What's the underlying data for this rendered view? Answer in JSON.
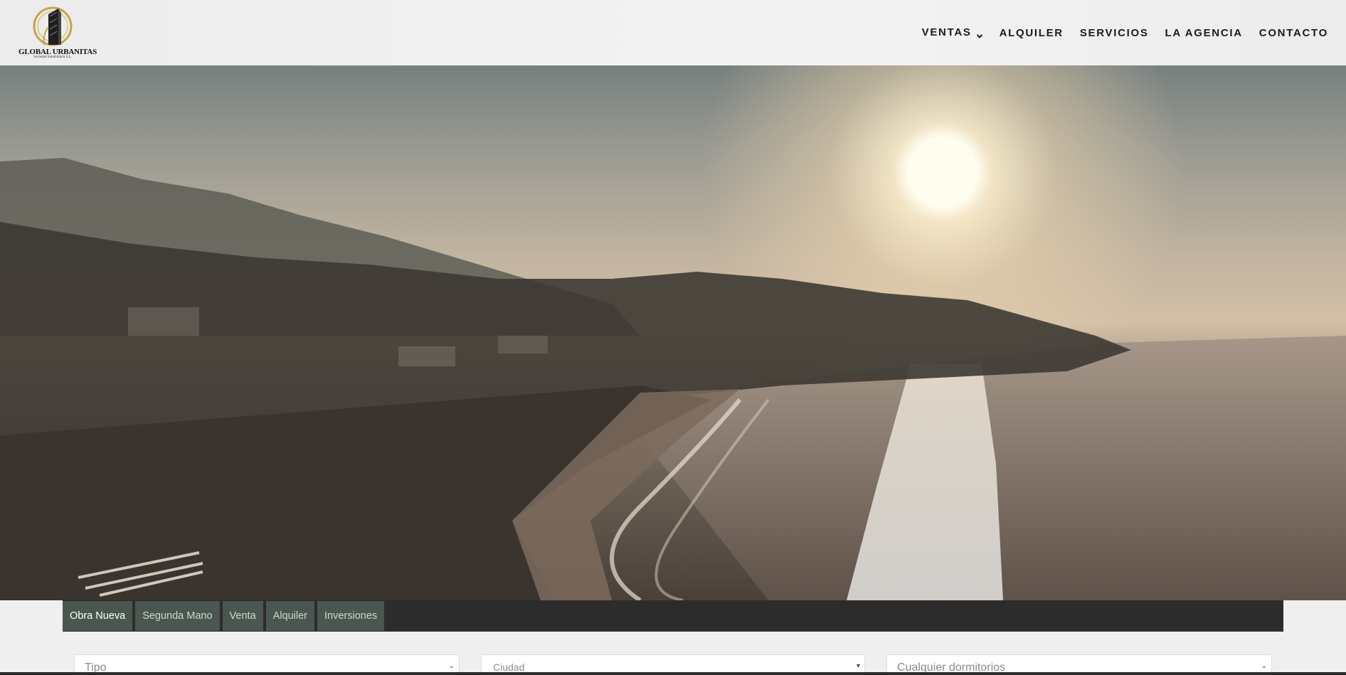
{
  "brand": {
    "name": "GLOBAL URBANITAS",
    "tagline": "Sociedad Inmobiliaria S.L.",
    "gold": "#c9a24b",
    "building_color": "#222222"
  },
  "nav": {
    "items": [
      {
        "label": "VENTAS",
        "has_dropdown": true
      },
      {
        "label": "ALQUILER"
      },
      {
        "label": "SERVICIOS"
      },
      {
        "label": "LA AGENCIA"
      },
      {
        "label": "CONTACTO"
      }
    ]
  },
  "hero": {
    "scene": "coastal sunset aerial view"
  },
  "search": {
    "tabs": [
      {
        "label": "Obra Nueva",
        "active": true
      },
      {
        "label": "Segunda Mano"
      },
      {
        "label": "Venta"
      },
      {
        "label": "Alquiler"
      },
      {
        "label": "Inversiones"
      }
    ],
    "fields": {
      "tipo": "Tipo",
      "ciudad": "Ciudad",
      "dormitorios": "Cualquier dormitorios"
    }
  },
  "colors": {
    "tabs_bar": "#2c2c2c",
    "tab_bg": "#4a5750"
  }
}
